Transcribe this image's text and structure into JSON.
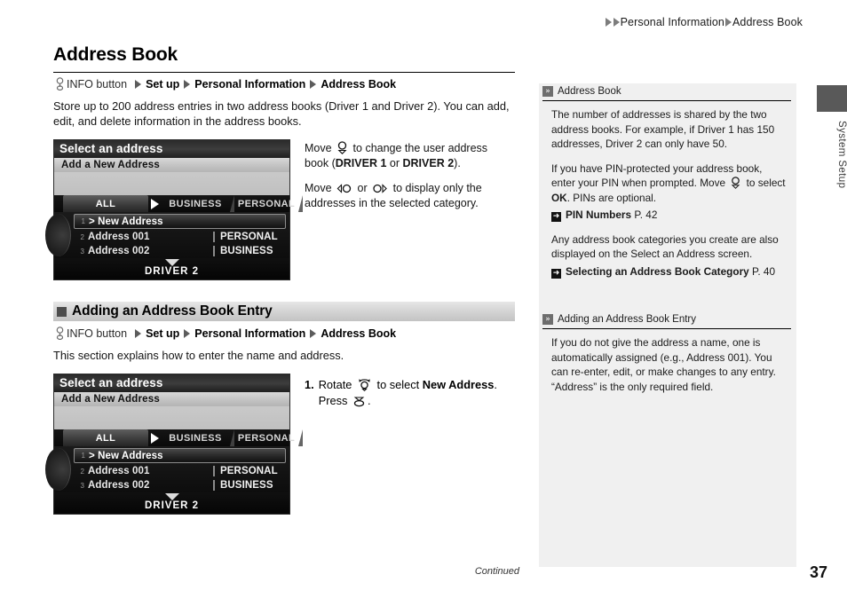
{
  "breadcrumb": {
    "items": [
      "Personal Information",
      "Address Book"
    ]
  },
  "side_tab": {
    "label": "System Setup"
  },
  "main": {
    "title": "Address Book",
    "nav_path": {
      "button_label": "INFO button",
      "steps": [
        "Set up",
        "Personal Information",
        "Address Book"
      ]
    },
    "intro": "Store up to 200 address entries in two address books (Driver 1 and Driver 2). You can add, edit, and delete information in the address books.",
    "figure_notes": {
      "note1_pre": "Move",
      "note1_mid": "to change the user address book (",
      "note1_b1": "DRIVER 1",
      "note1_or": "or",
      "note1_b2": "DRIVER 2",
      "note1_end": ").",
      "note2_pre": "Move",
      "note2_or": "or",
      "note2_end": "to display only the addresses in the selected category."
    },
    "section": {
      "heading": "Adding an Address Book Entry",
      "nav_path": {
        "button_label": "INFO button",
        "steps": [
          "Set up",
          "Personal Information",
          "Address Book"
        ]
      },
      "intro": "This section explains how to enter the name and address.",
      "step": {
        "number": "1.",
        "pre": "Rotate",
        "mid": "to select",
        "target": "New Address",
        "period": ".",
        "press": "Press",
        "press_end": "."
      }
    }
  },
  "nav_screen": {
    "title": "Select an address",
    "subtitle": "Add a New Address",
    "tabs": [
      "ALL",
      "BUSINESS",
      "PERSONAL"
    ],
    "rows": [
      {
        "num": "1",
        "label": "> New Address",
        "category": "",
        "selected": true
      },
      {
        "num": "2",
        "label": "Address 001",
        "category": "PERSONAL",
        "selected": false
      },
      {
        "num": "3",
        "label": "Address 002",
        "category": "BUSINESS",
        "selected": false
      }
    ],
    "footer": "DRIVER 2"
  },
  "panel": {
    "sections": [
      {
        "header": "Address Book",
        "paragraphs": [
          "The number of addresses is shared by the two address books. For example, if Driver 1 has 150 addresses, Driver 2 can only have 50."
        ],
        "pin_pre": "If you have PIN-protected your address book, enter your PIN when prompted. Move",
        "pin_mid": "to select",
        "pin_ok": "OK",
        "pin_end": ". PINs are optional.",
        "ref1_title": "PIN Numbers",
        "ref1_page": "P. 42",
        "paragraph2": "Any address book categories you create are also displayed on the Select an Address screen.",
        "ref2_title": "Selecting an Address Book Category",
        "ref2_page": "P. 40"
      },
      {
        "header": "Adding an Address Book Entry",
        "paragraphs": [
          "If you do not give the address a name, one is automatically assigned (e.g., Address 001). You can re-enter, edit, or make changes to any entry. “Address” is the only required field."
        ]
      }
    ]
  },
  "footer": {
    "continued": "Continued",
    "page_number": "37"
  },
  "colors": {
    "panel_bg": "#f0f0f0",
    "section_head": "#d2d2d2",
    "side_tab": "#595959",
    "screen_bg": "#000000"
  }
}
